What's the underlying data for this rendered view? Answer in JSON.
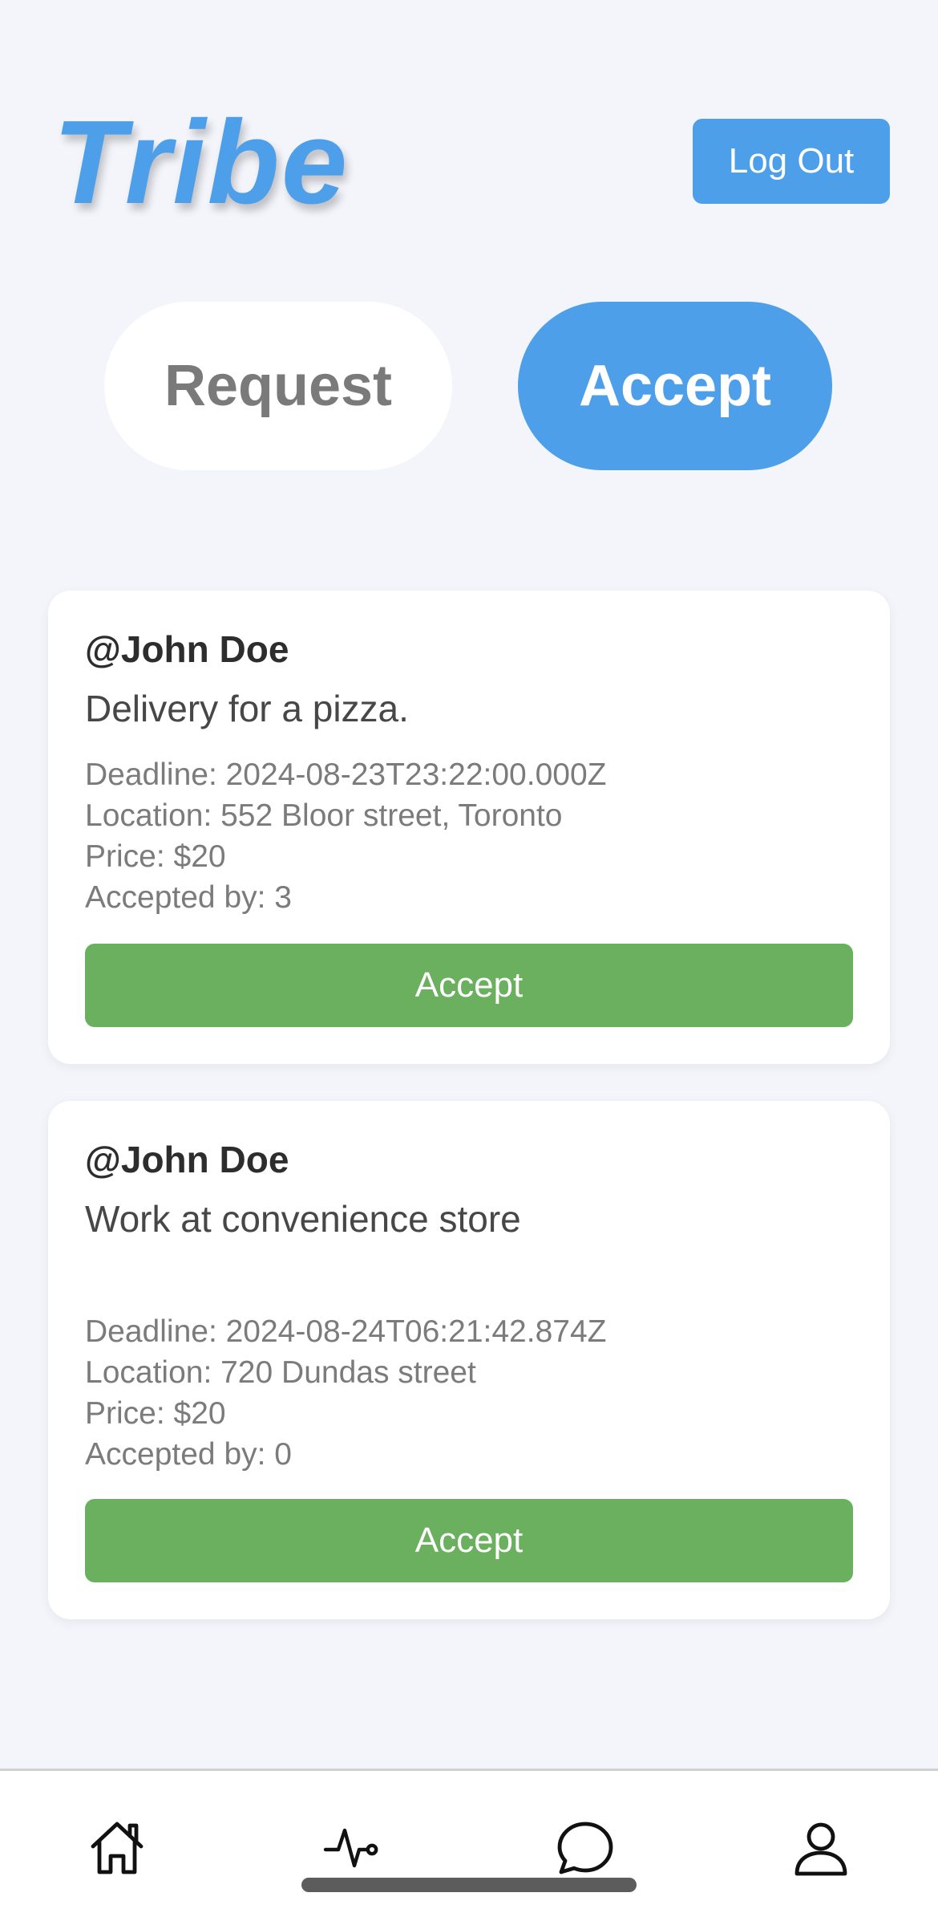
{
  "app": {
    "title": "Tribe",
    "logout_label": "Log Out"
  },
  "toggle": {
    "request_label": "Request",
    "accept_label": "Accept",
    "active": "Accept"
  },
  "tasks": [
    {
      "user": "@John Doe",
      "description": "Delivery for a pizza.",
      "deadline": "Deadline: 2024-08-23T23:22:00.000Z",
      "location": "Location: 552 Bloor street, Toronto",
      "price": "Price: $20",
      "accepted_by": "Accepted by: 3",
      "button_label": "Accept"
    },
    {
      "user": "@John Doe",
      "description": "Work at convenience store",
      "deadline": "Deadline: 2024-08-24T06:21:42.874Z",
      "location": "Location: 720 Dundas street",
      "price": "Price: $20",
      "accepted_by": "Accepted by: 0",
      "button_label": "Accept"
    }
  ],
  "tabbar": {
    "items": [
      "home-icon",
      "activity-icon",
      "chat-icon",
      "profile-icon"
    ]
  },
  "colors": {
    "brand": "#4e9fea",
    "accept_button": "#6ab05e",
    "background": "#f3f5fb"
  }
}
